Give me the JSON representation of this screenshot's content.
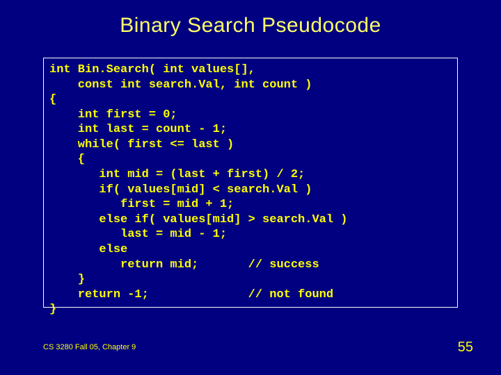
{
  "title": "Binary Search Pseudocode",
  "code": "int Bin.Search( int values[],\n    const int search.Val, int count )\n{\n    int first = 0;\n    int last = count - 1;\n    while( first <= last )\n    {\n       int mid = (last + first) / 2;\n       if( values[mid] < search.Val )\n          first = mid + 1;\n       else if( values[mid] > search.Val )\n          last = mid - 1;\n       else\n          return mid;       // success\n    }\n    return -1;              // not found\n}",
  "footer_left": "CS 3280 Fall 05, Chapter 9",
  "footer_right": "55"
}
